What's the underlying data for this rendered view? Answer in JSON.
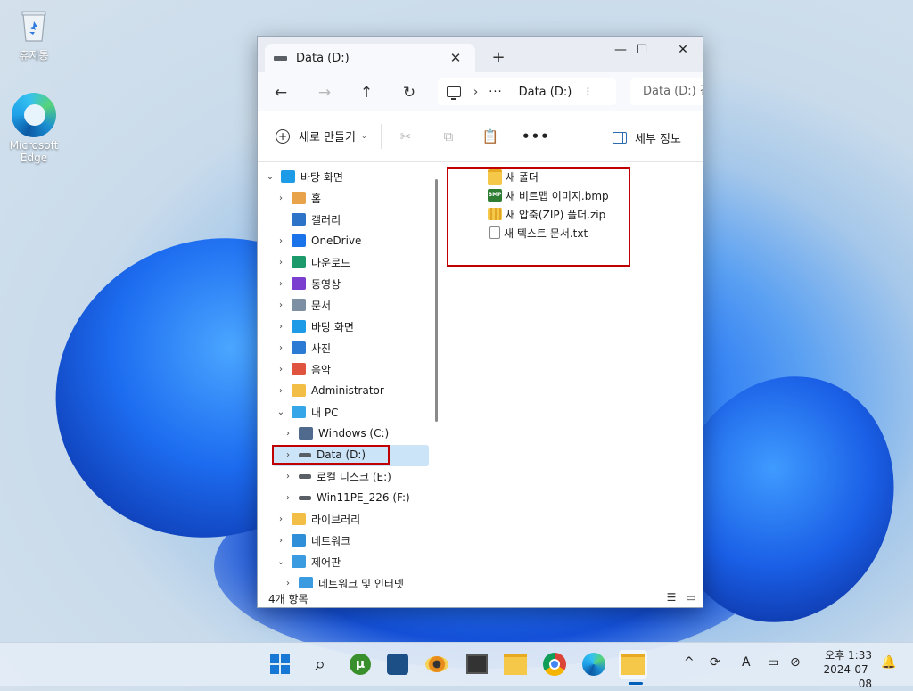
{
  "desktop": {
    "icons": [
      {
        "label": "휴지통"
      },
      {
        "label": "Microsoft Edge"
      }
    ]
  },
  "window": {
    "tab_title": "Data (D:)",
    "tab_close": "✕",
    "new_tab": "+",
    "controls": {
      "minimize": "—",
      "maximize": "☐",
      "close": "✕"
    }
  },
  "navbar": {
    "back": "←",
    "forward": "→",
    "up": "↑",
    "refresh": "↻",
    "address": {
      "sep": "›",
      "dots": "···",
      "location": "Data (D:)",
      "more": "⁝"
    },
    "search_placeholder": "Data (D:) 검색"
  },
  "toolbar": {
    "new_label": "새로 만들기",
    "new_caret": "⌄",
    "cut_icon": "✂",
    "copy_icon": "⧉",
    "paste_icon": "📋",
    "more_icon": "•••",
    "details_label": "세부 정보"
  },
  "nav_tree": [
    {
      "label": "바탕 화면",
      "chevron": "⌄",
      "icon_color": "#1e9be6",
      "level": 0
    },
    {
      "label": "홈",
      "chevron": "›",
      "icon_color": "#e8a34a",
      "level": 1
    },
    {
      "label": "갤러리",
      "chevron": "",
      "icon_color": "#2d74c8",
      "level": 1
    },
    {
      "label": "OneDrive",
      "chevron": "›",
      "icon_color": "#1a73e8",
      "level": 1
    },
    {
      "label": "다운로드",
      "chevron": "›",
      "icon_color": "#1d9a6c",
      "level": 1
    },
    {
      "label": "동영상",
      "chevron": "›",
      "icon_color": "#7b3fd0",
      "level": 1
    },
    {
      "label": "문서",
      "chevron": "›",
      "icon_color": "#7d8fa3",
      "level": 1
    },
    {
      "label": "바탕 화면",
      "chevron": "›",
      "icon_color": "#1e9be6",
      "level": 1
    },
    {
      "label": "사진",
      "chevron": "›",
      "icon_color": "#2b7bd4",
      "level": 1
    },
    {
      "label": "음악",
      "chevron": "›",
      "icon_color": "#e0533e",
      "level": 1
    },
    {
      "label": "Administrator",
      "chevron": "›",
      "icon_color": "#f2be45",
      "level": 1
    },
    {
      "label": "내 PC",
      "chevron": "⌄",
      "icon_color": "#35a6e8",
      "level": 1
    },
    {
      "label": "Windows (C:)",
      "chevron": "›",
      "icon_color": "#4f6a8c",
      "level": 2
    },
    {
      "label": "Data (D:)",
      "chevron": "›",
      "icon_color": "#5a5f66",
      "level": 2
    },
    {
      "label": "로컬 디스크 (E:)",
      "chevron": "›",
      "icon_color": "#5a5f66",
      "level": 2
    },
    {
      "label": "Win11PE_226 (F:)",
      "chevron": "›",
      "icon_color": "#5a5f66",
      "level": 2
    },
    {
      "label": "라이브러리",
      "chevron": "›",
      "icon_color": "#f2be45",
      "level": 1
    },
    {
      "label": "네트워크",
      "chevron": "›",
      "icon_color": "#2f8fd8",
      "level": 1
    },
    {
      "label": "제어판",
      "chevron": "⌄",
      "icon_color": "#3a9be0",
      "level": 1
    },
    {
      "label": "네트워크 및 인터넷",
      "chevron": "›",
      "icon_color": "#3a9be0",
      "level": 2
    }
  ],
  "files": [
    {
      "name": "새 폴더",
      "type": "folder"
    },
    {
      "name": "새 비트맵 이미지.bmp",
      "type": "bmp",
      "badge": "BMP"
    },
    {
      "name": "새 압축(ZIP) 폴더.zip",
      "type": "zip"
    },
    {
      "name": "새 텍스트 문서.txt",
      "type": "txt"
    }
  ],
  "status": {
    "item_count": "4개 항목",
    "list_view_icon": "☰",
    "tile_view_icon": "▭"
  },
  "taskbar": {
    "start_icon": "windows-logo",
    "search_icon": "⌕",
    "tray_chevron": "^",
    "ime": "A",
    "clock_time": "오후 1:33",
    "clock_date": "2024-07-08",
    "notification_icon": "🔔"
  }
}
